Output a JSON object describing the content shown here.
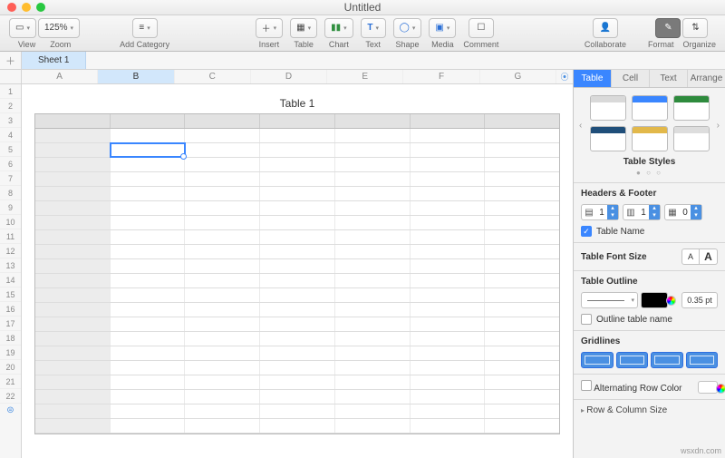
{
  "window": {
    "title": "Untitled"
  },
  "toolbar": {
    "view_label": "View",
    "zoom_value": "125%",
    "zoom_label": "Zoom",
    "addcat_label": "Add Category",
    "insert_label": "Insert",
    "table_label": "Table",
    "chart_label": "Chart",
    "text_label": "Text",
    "shape_label": "Shape",
    "media_label": "Media",
    "comment_label": "Comment",
    "collaborate_label": "Collaborate",
    "format_label": "Format",
    "organize_label": "Organize"
  },
  "sheets": {
    "tab1": "Sheet 1"
  },
  "columns": [
    "A",
    "B",
    "C",
    "D",
    "E",
    "F",
    "G"
  ],
  "rows": [
    "1",
    "2",
    "3",
    "4",
    "5",
    "6",
    "7",
    "8",
    "9",
    "10",
    "11",
    "12",
    "13",
    "14",
    "15",
    "16",
    "17",
    "18",
    "19",
    "20",
    "21",
    "22"
  ],
  "table": {
    "name": "Table 1"
  },
  "inspector": {
    "tabs": {
      "table": "Table",
      "cell": "Cell",
      "text": "Text",
      "arrange": "Arrange"
    },
    "styles_label": "Table Styles",
    "headers_footer": "Headers & Footer",
    "hf": {
      "header_rows": "1",
      "header_cols": "1",
      "footer_rows": "0"
    },
    "table_name_cb": "Table Name",
    "font_size_label": "Table Font Size",
    "outline_label": "Table Outline",
    "outline_pt": "0.35 pt",
    "outline_tablename": "Outline table name",
    "gridlines_label": "Gridlines",
    "alt_row_label": "Alternating Row Color",
    "rowcol_label": "Row & Column Size"
  },
  "watermark": "wsxdn.com"
}
